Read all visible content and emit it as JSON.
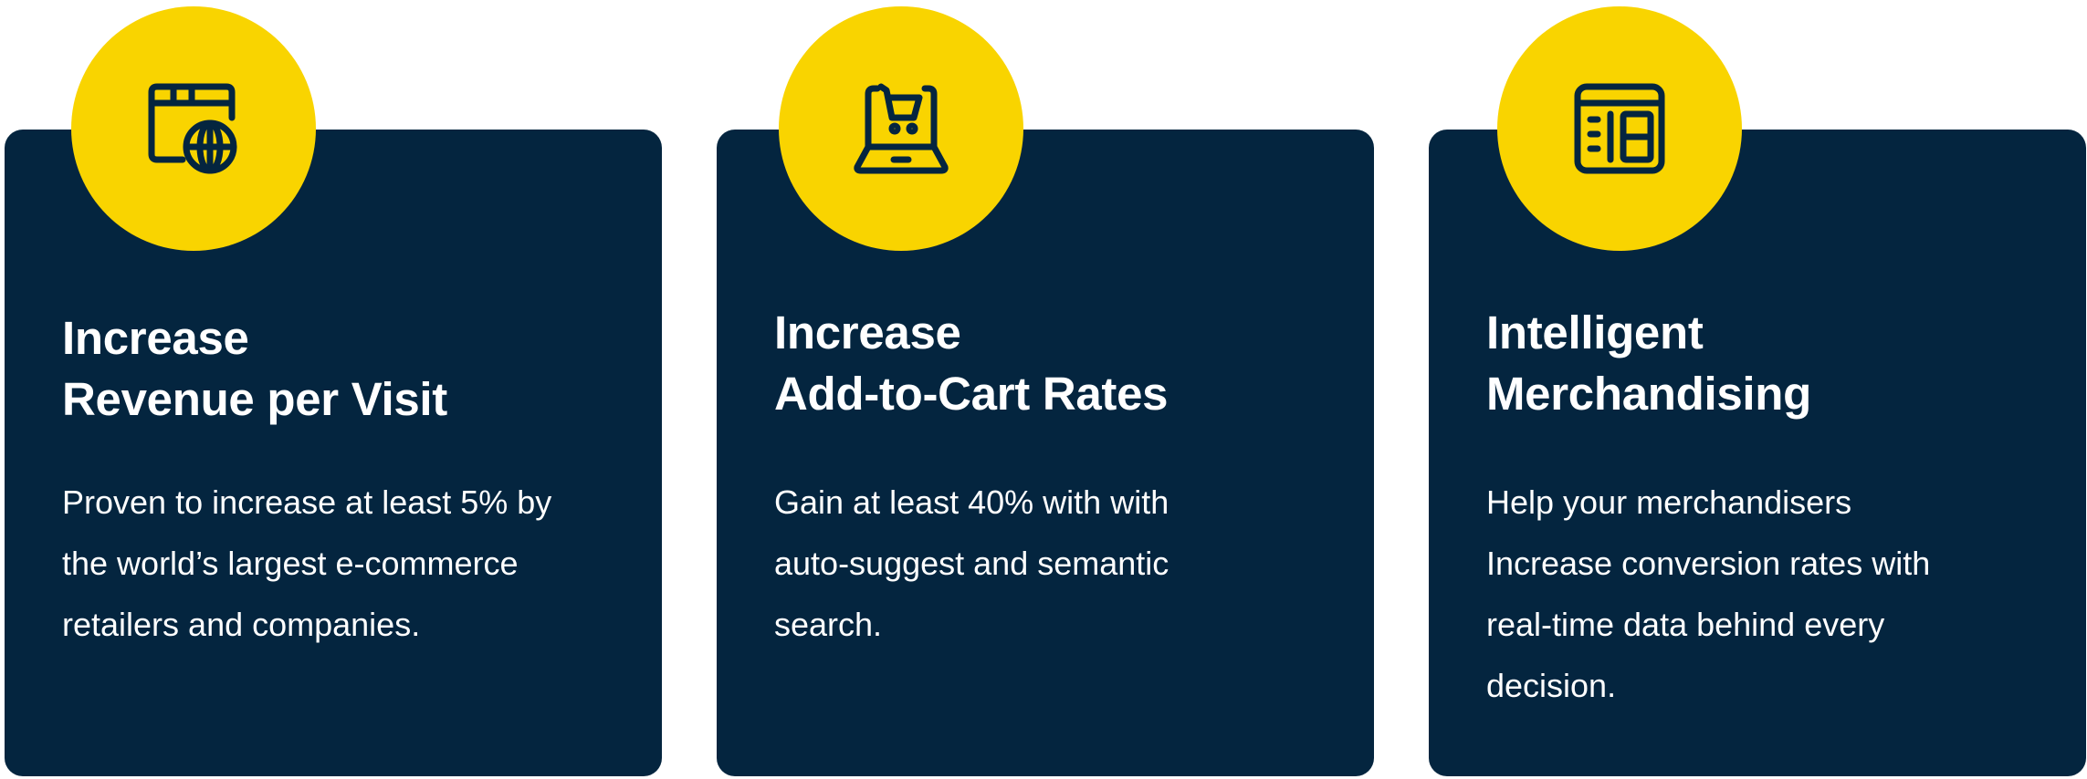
{
  "colors": {
    "card_background": "#04253f",
    "badge_yellow": "#f9d400",
    "icon_stroke": "#04253f",
    "text": "#ffffff"
  },
  "cards": [
    {
      "icon": "browser-globe-icon",
      "title_lines": [
        "Increase",
        "Revenue per Visit"
      ],
      "description_lines": [
        "Proven to increase at least 5% by",
        "the world’s largest e-commerce",
        "retailers and companies."
      ]
    },
    {
      "icon": "laptop-cart-icon",
      "title_lines": [
        "Increase",
        "Add-to-Cart Rates"
      ],
      "description_lines": [
        "Gain at least 40% with with",
        "auto-suggest and semantic",
        "search."
      ]
    },
    {
      "icon": "layout-dashboard-icon",
      "title_lines": [
        "Intelligent",
        "Merchandising"
      ],
      "description_lines": [
        "Help your merchandisers",
        "Increase conversion rates with",
        "real-time data behind every",
        "decision."
      ]
    }
  ]
}
